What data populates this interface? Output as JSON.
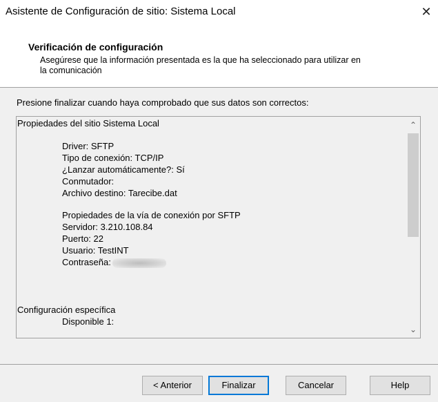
{
  "window": {
    "title": "Asistente de Configuración de sitio: Sistema Local",
    "close_glyph": "✕"
  },
  "header": {
    "title": "Verificación de configuración",
    "subtitle": "Asegúrese que la información presentada es la que ha seleccionado para utilizar en la comunicación"
  },
  "prompt": "Presione finalizar cuando haya comprobado que sus datos son correctos:",
  "details": {
    "lines": [
      "Propiedades del sitio Sistema Local",
      "Driver: SFTP",
      "Tipo de conexión: TCP/IP",
      "¿Lanzar automáticamente?: Sí",
      "Conmutador:",
      "Archivo destino: Tarecibe.dat",
      "Propiedades de la vía de conexión por SFTP",
      "Servidor: 3.210.108.84",
      "Puerto: 22",
      "Usuario: TestINT",
      "Contraseña:",
      "Configuración específica",
      "Disponible 1:"
    ]
  },
  "buttons": {
    "back": "< Anterior",
    "finish": "Finalizar",
    "cancel": "Cancelar",
    "help": "Help"
  }
}
